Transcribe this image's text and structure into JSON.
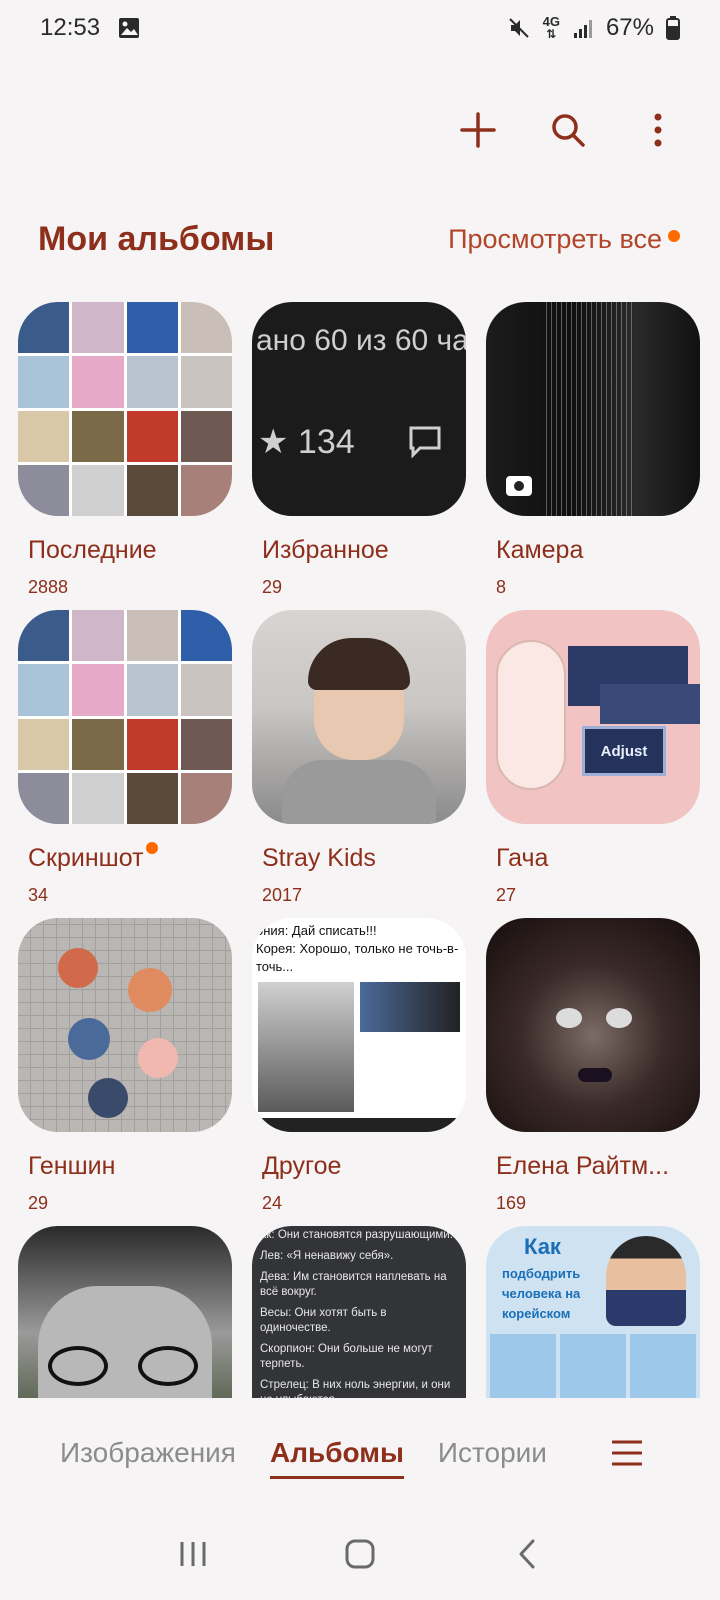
{
  "status_bar": {
    "time": "12:53",
    "network": "4G",
    "battery": "67%"
  },
  "top_actions": {
    "add_icon": "plus-icon",
    "search_icon": "search-icon",
    "more_icon": "more-vert-icon"
  },
  "header": {
    "title": "Мои альбомы",
    "view_all": "Просмотреть все"
  },
  "albums": [
    {
      "name": "Последние",
      "count": "2888"
    },
    {
      "name": "Избранное",
      "count": "29",
      "thumb_text_1": "ано 60 из 60 ча",
      "thumb_text_2": "★ 134"
    },
    {
      "name": "Камера",
      "count": "8"
    },
    {
      "name": "Скриншот",
      "count": "34"
    },
    {
      "name": "Stray Kids",
      "count": "2017"
    },
    {
      "name": "Гача",
      "count": "27",
      "thumb_text": "Adjust"
    },
    {
      "name": "Геншин",
      "count": "29"
    },
    {
      "name": "Другое",
      "count": "24",
      "thumb_text_1": "ония: Дай списать!!!",
      "thumb_text_2": "Корея: Хорошо, только не точь-в-точь..."
    },
    {
      "name": "Елена Райтм...",
      "count": "169"
    },
    {
      "name": "",
      "count": ""
    },
    {
      "name": "",
      "count": "",
      "thumb_lines": [
        "ак: Они становятся разрушающими.",
        "Лев: «Я ненавижу себя».",
        "Дева: Им становится наплевать на всё вокруг.",
        "Весы: Они хотят быть в одиночестве.",
        "Скорпион: Они больше не могут терпеть.",
        "Стрелец: В них ноль энергии, и они не улыбаются."
      ]
    },
    {
      "name": "",
      "count": "",
      "thumb_text_1": "Как",
      "thumb_text_2": "подбодрить человека на корейском"
    }
  ],
  "bottom_nav": {
    "tab_images": "Изображения",
    "tab_albums": "Альбомы",
    "tab_stories": "Истории"
  },
  "colors": {
    "accent": "#8e2f1c",
    "link": "#b3452b",
    "badge": "#ff6a00",
    "background": "#f6f4f4"
  }
}
